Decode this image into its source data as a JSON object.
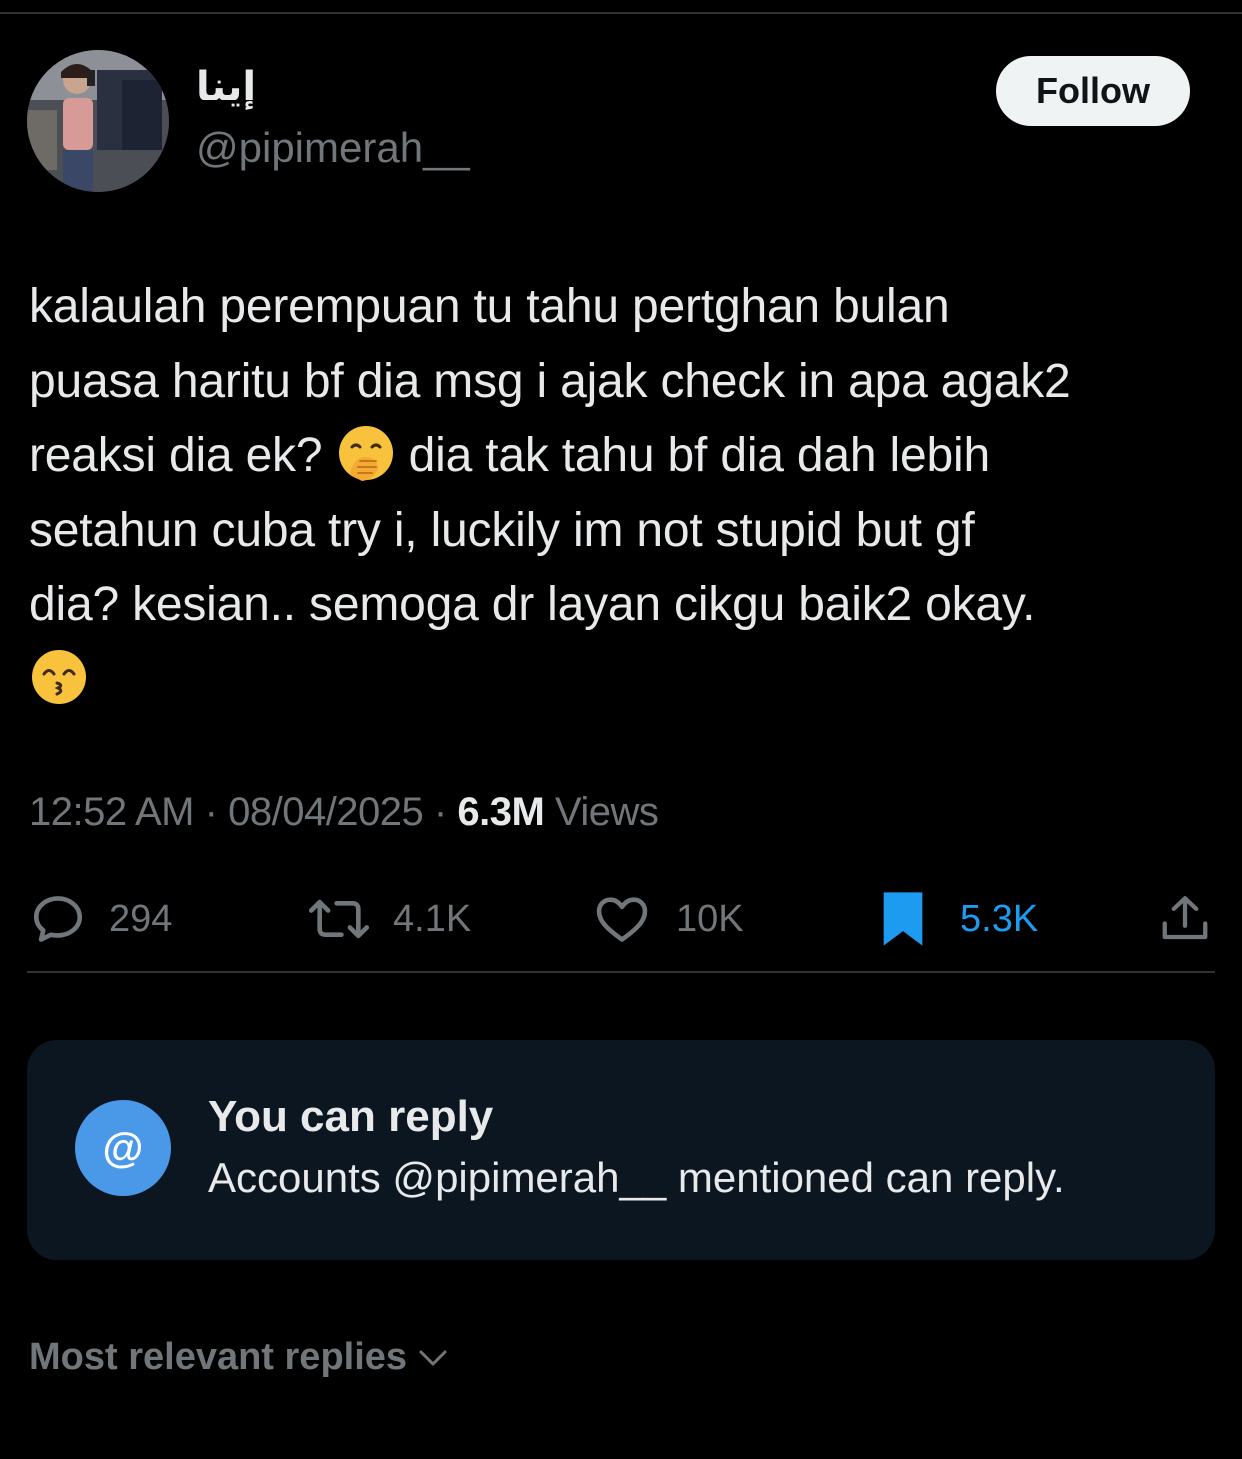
{
  "author": {
    "display_name": "إينا",
    "handle": "@pipimerah__"
  },
  "follow_label": "Follow",
  "tweet": {
    "lines": [
      "kalaulah perempuan tu tahu pertghan bulan",
      "puasa haritu bf dia msg i ajak check in apa agak2",
      "reaksi dia ek?",
      "dia tak tahu bf dia dah lebih",
      "setahun cuba try i, luckily im not stupid but gf",
      "dia? kesian.. semoga dr layan cikgu baik2 okay."
    ],
    "emoji_1": "face-with-hand-over-mouth-emoji",
    "emoji_2": "kissing-face-with-smiling-eyes-emoji"
  },
  "meta": {
    "time": "12:52 AM",
    "sep1": "·",
    "date": "08/04/2025",
    "sep2": "·",
    "views_count": "6.3M",
    "views_label": "Views"
  },
  "actions": {
    "replies": "294",
    "reposts": "4.1K",
    "likes": "10K",
    "bookmarks": "5.3K"
  },
  "reply_settings": {
    "icon": "@",
    "title": "You can reply",
    "subtitle": "Accounts @pipimerah__ mentioned can reply."
  },
  "sort_label": "Most relevant replies",
  "colors": {
    "background": "#000000",
    "text": "#e7e9ea",
    "muted": "#71767b",
    "accent": "#1d9bf0",
    "reply_box": "#0c1621"
  }
}
